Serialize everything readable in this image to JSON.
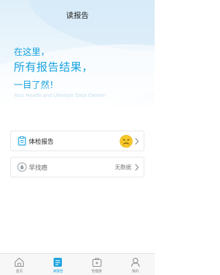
{
  "header": {
    "title": "读报告"
  },
  "hero": {
    "line1": "在这里，",
    "line2": "所有报告结果，",
    "line3": "一目了然！",
    "subtitle": "Your Health and Lifestyle Data Center!"
  },
  "cards": [
    {
      "label": "体检报告",
      "status_icon": "sad-face-icon"
    },
    {
      "label": "早找癌",
      "value": "无数据"
    }
  ],
  "tabbar": {
    "items": [
      {
        "label": "首页",
        "icon": "home-icon"
      },
      {
        "label": "读报告",
        "icon": "report-icon",
        "active": true
      },
      {
        "label": "管健康",
        "icon": "health-box-icon"
      },
      {
        "label": "我的",
        "icon": "user-icon"
      }
    ]
  },
  "colors": {
    "accent": "#1aa3e0",
    "face": "#f6c62a"
  }
}
